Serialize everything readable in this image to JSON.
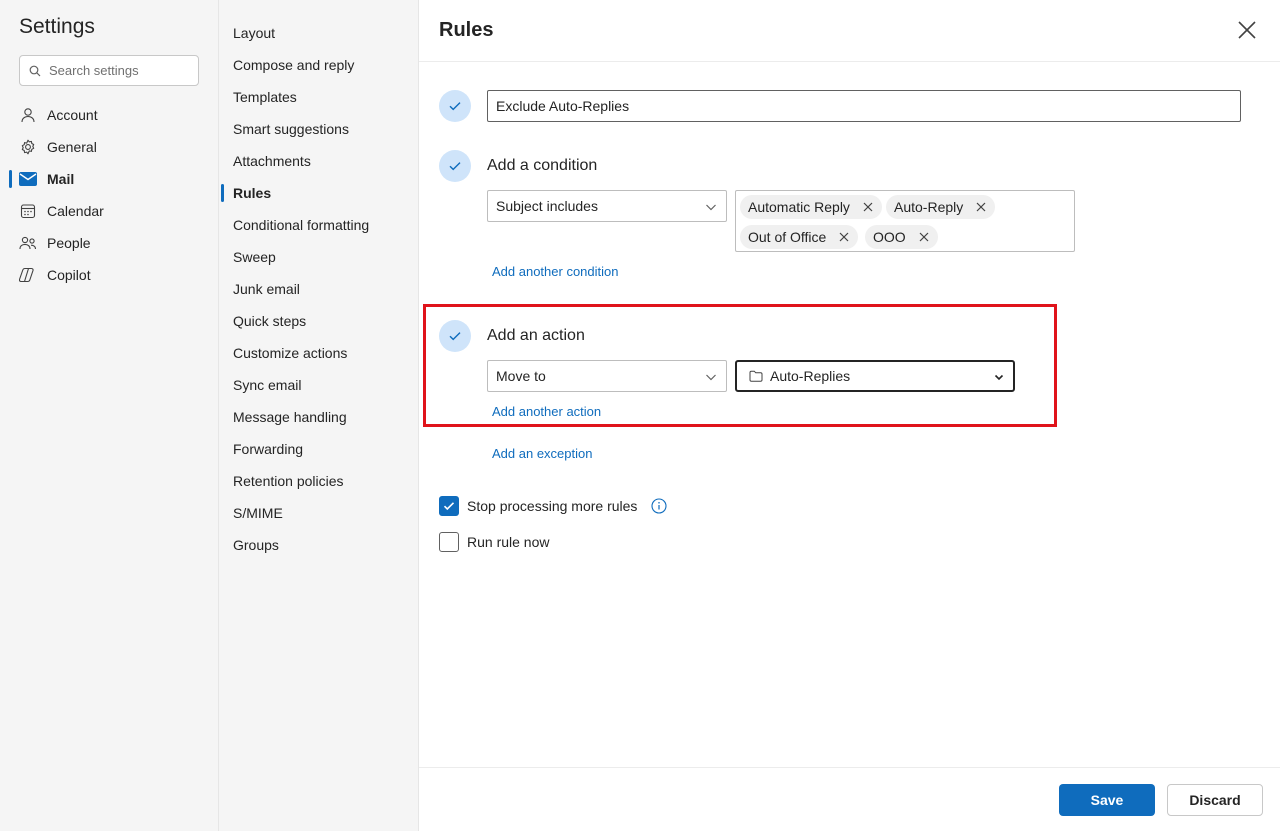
{
  "settings": {
    "title": "Settings",
    "search_placeholder": "Search settings",
    "nav": [
      {
        "label": "Account",
        "icon": "person-icon"
      },
      {
        "label": "General",
        "icon": "gear-icon"
      },
      {
        "label": "Mail",
        "icon": "mail-icon",
        "active": true
      },
      {
        "label": "Calendar",
        "icon": "calendar-icon"
      },
      {
        "label": "People",
        "icon": "people-icon"
      },
      {
        "label": "Copilot",
        "icon": "copilot-icon"
      }
    ]
  },
  "mail_nav": [
    {
      "label": "Layout"
    },
    {
      "label": "Compose and reply"
    },
    {
      "label": "Templates"
    },
    {
      "label": "Smart suggestions"
    },
    {
      "label": "Attachments"
    },
    {
      "label": "Rules",
      "active": true
    },
    {
      "label": "Conditional formatting"
    },
    {
      "label": "Sweep"
    },
    {
      "label": "Junk email"
    },
    {
      "label": "Quick steps"
    },
    {
      "label": "Customize actions"
    },
    {
      "label": "Sync email"
    },
    {
      "label": "Message handling"
    },
    {
      "label": "Forwarding"
    },
    {
      "label": "Retention policies"
    },
    {
      "label": "S/MIME"
    },
    {
      "label": "Groups"
    }
  ],
  "rules": {
    "title": "Rules",
    "rule_name": "Exclude Auto-Replies",
    "condition": {
      "title": "Add a condition",
      "type": "Subject includes",
      "tags": [
        "Automatic Reply",
        "Auto-Reply",
        "Out of Office",
        "OOO"
      ],
      "add_link": "Add another condition"
    },
    "action": {
      "title": "Add an action",
      "type": "Move to",
      "folder": "Auto-Replies",
      "add_link": "Add another action"
    },
    "exception_link": "Add an exception",
    "stop_processing": {
      "label": "Stop processing more rules",
      "checked": true
    },
    "run_now": {
      "label": "Run rule now",
      "checked": false
    },
    "save_label": "Save",
    "discard_label": "Discard"
  },
  "colors": {
    "accent": "#0f6cbd",
    "highlight": "#e0131b",
    "step_bg": "#cfe4fa"
  }
}
